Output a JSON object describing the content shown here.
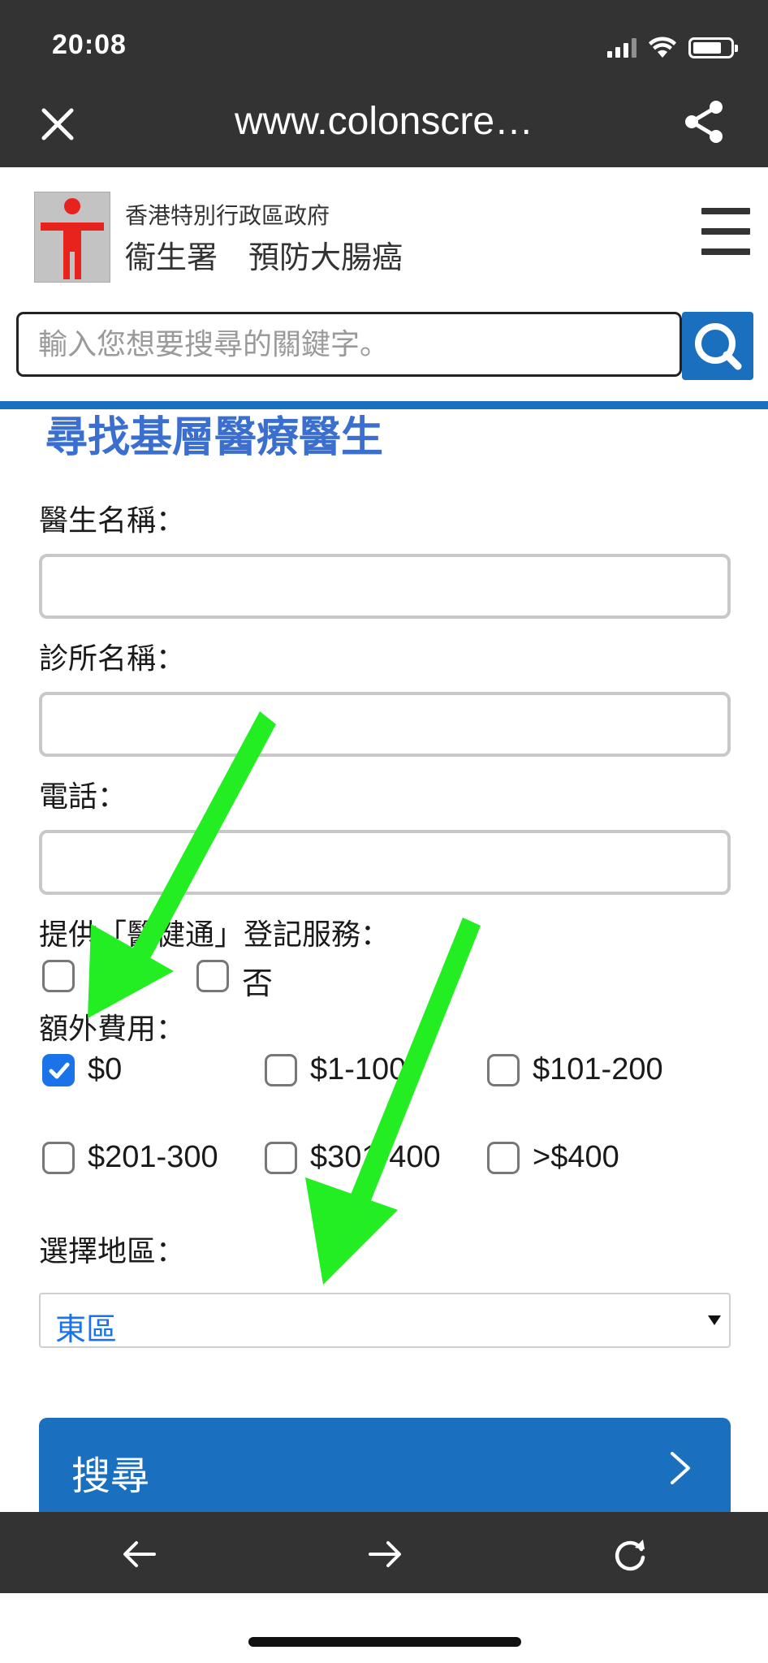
{
  "status_bar": {
    "time": "20:08"
  },
  "browser": {
    "url": "www.colonscre…",
    "icons": {
      "close": "close-icon",
      "share": "share-icon",
      "back": "back-arrow-icon",
      "forward": "forward-arrow-icon",
      "reload": "reload-icon"
    }
  },
  "header": {
    "gov_name": "香港特別行政區政府",
    "dept_name": "衞生署　預防大腸癌",
    "menu_icon": "hamburger-menu-icon"
  },
  "search": {
    "placeholder": "輸入您想要搜尋的關鍵字。",
    "value": "",
    "icon": "search-icon"
  },
  "form": {
    "title": "尋找基層醫療醫生",
    "doctor_name_label": "醫生名稱：",
    "clinic_name_label": "診所名稱：",
    "phone_label": "電話：",
    "ehealth_label": "提供「醫健通」登記服務：",
    "ehealth_options": [
      {
        "label": "是",
        "checked": false
      },
      {
        "label": "否",
        "checked": false
      }
    ],
    "fee_label": "額外費用：",
    "fee_options": [
      {
        "label": "$0",
        "checked": true
      },
      {
        "label": "$1-100",
        "checked": false
      },
      {
        "label": "$101-200",
        "checked": false
      },
      {
        "label": "$201-300",
        "checked": false
      },
      {
        "label": "$301-400",
        "checked": false
      },
      {
        "label": ">$400",
        "checked": false
      }
    ],
    "district_label": "選擇地區：",
    "district_value": "東區",
    "submit_label": "搜尋"
  },
  "colors": {
    "browser_bar": "#333333",
    "brand_blue": "#1a6fbf",
    "title_blue": "#3b6fcf",
    "checkbox_checked": "#1a73e8",
    "annotation_arrow": "#22ee22"
  }
}
